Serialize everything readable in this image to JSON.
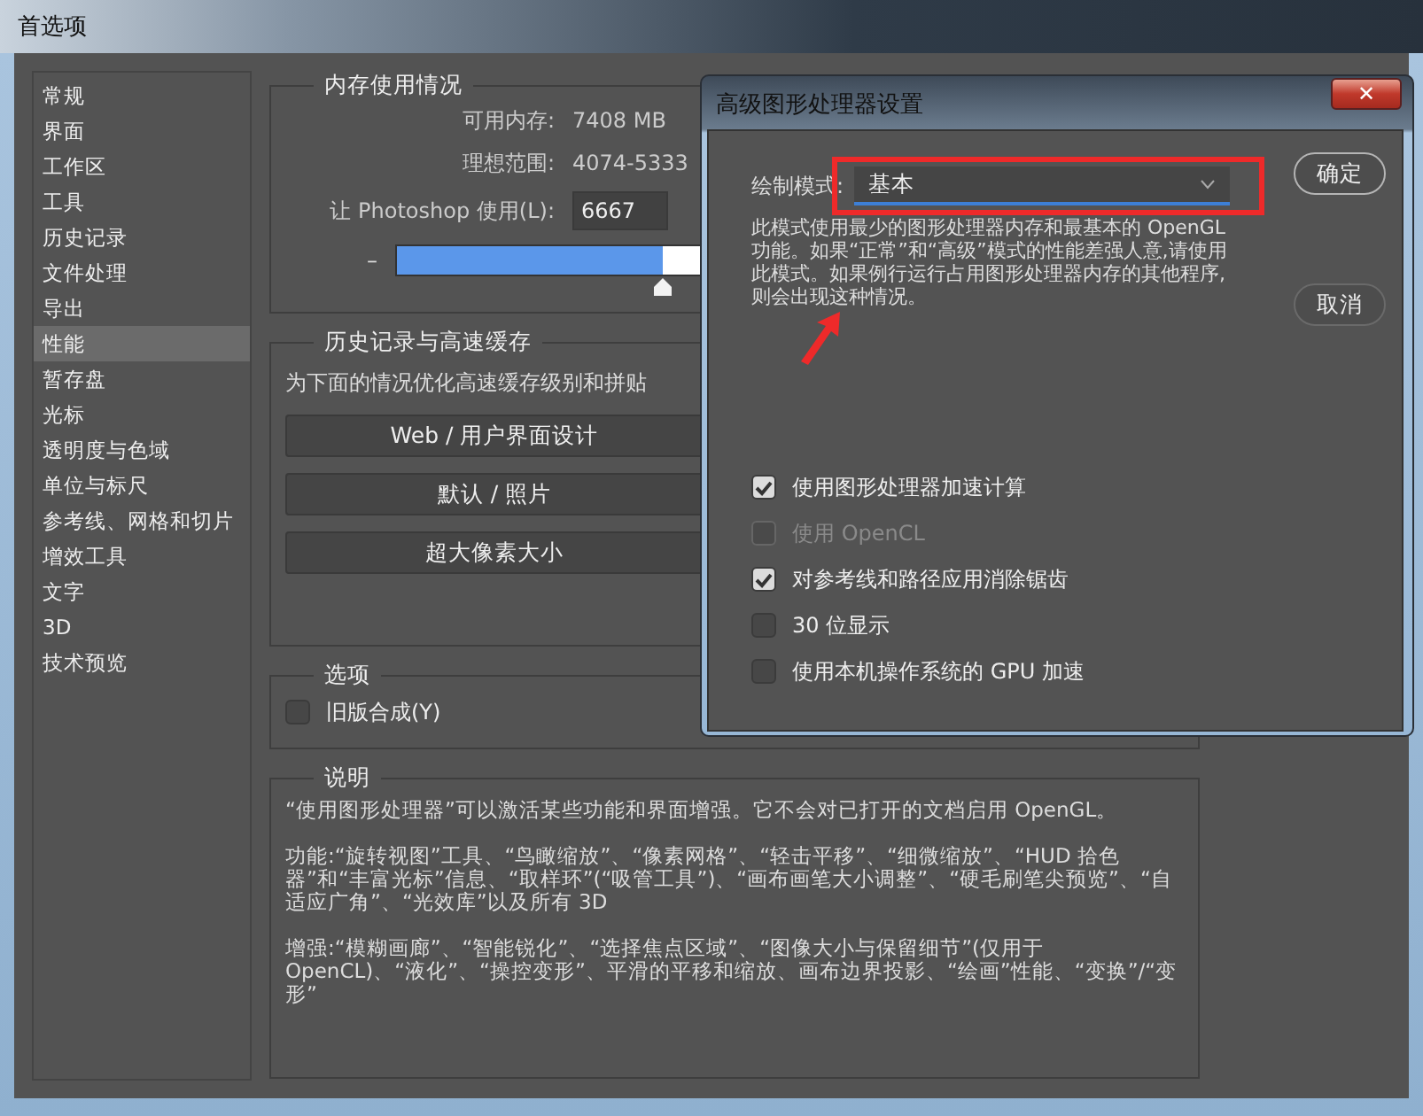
{
  "window": {
    "title": "首选项"
  },
  "sidebar": {
    "items": [
      {
        "label": "常规",
        "selected": false
      },
      {
        "label": "界面",
        "selected": false
      },
      {
        "label": "工作区",
        "selected": false
      },
      {
        "label": "工具",
        "selected": false
      },
      {
        "label": "历史记录",
        "selected": false
      },
      {
        "label": "文件处理",
        "selected": false
      },
      {
        "label": "导出",
        "selected": false
      },
      {
        "label": "性能",
        "selected": true
      },
      {
        "label": "暂存盘",
        "selected": false
      },
      {
        "label": "光标",
        "selected": false
      },
      {
        "label": "透明度与色域",
        "selected": false
      },
      {
        "label": "单位与标尺",
        "selected": false
      },
      {
        "label": "参考线、网格和切片",
        "selected": false
      },
      {
        "label": "增效工具",
        "selected": false
      },
      {
        "label": "文字",
        "selected": false
      },
      {
        "label": "3D",
        "selected": false
      },
      {
        "label": "技术预览",
        "selected": false
      }
    ]
  },
  "memory": {
    "title": "内存使用情况",
    "rows": [
      {
        "label": "可用内存:",
        "value": "7408 MB"
      },
      {
        "label": "理想范围:",
        "value": "4074-5333"
      }
    ],
    "use_label": "让 Photoshop 使用(L):",
    "use_value": "6667",
    "minus": "–",
    "level": 0.8
  },
  "history_cache": {
    "title": "历史记录与高速缓存",
    "text": "为下面的情况优化高速缓存级别和拼贴",
    "buttons": [
      "Web / 用户界面设计",
      "默认 / 照片",
      "超大像素大小"
    ]
  },
  "options": {
    "title": "选项",
    "items": [
      {
        "label": "旧版合成(Y)",
        "checked": false
      }
    ]
  },
  "description": {
    "title": "说明",
    "paragraphs": [
      "“使用图形处理器”可以激活某些功能和界面增强。它不会对已打开的文档启用 OpenGL。",
      "功能:“旋转视图”工具、“鸟瞰缩放”、“像素网格”、“轻击平移”、“细微缩放”、“HUD 拾色器”和“丰富光标”信息、“取样环”(“吸管工具”)、“画布画笔大小调整”、“硬毛刷笔尖预览”、“自适应广角”、“光效库”以及所有 3D",
      "增强:“模糊画廊”、“智能锐化”、“选择焦点区域”、“图像大小与保留细节”(仅用于 OpenCL)、“液化”、“操控变形”、平滑的平移和缩放、画布边界投影、“绘画”性能、“变换”/“变形”"
    ]
  },
  "dialog": {
    "title": "高级图形处理器设置",
    "close": "✕",
    "mode_label": "绘制模式:",
    "mode_value": "基本",
    "mode_text": "此模式使用最少的图形处理器内存和最基本的 OpenGL 功能。如果“正常”和“高级”模式的性能差强人意,请使用此模式。如果例行运行占用图形处理器内存的其他程序,则会出现这种情况。",
    "buttons": [
      "确定",
      "取消"
    ],
    "checkboxes": [
      {
        "label": "使用图形处理器加速计算",
        "checked": true,
        "disabled": false
      },
      {
        "label": "使用 OpenCL",
        "checked": false,
        "disabled": true
      },
      {
        "label": "对参考线和路径应用消除锯齿",
        "checked": true,
        "disabled": false
      },
      {
        "label": "30 位显示",
        "checked": false,
        "disabled": false
      },
      {
        "label": "使用本机操作系统的 GPU 加速",
        "checked": false,
        "disabled": false
      }
    ]
  }
}
